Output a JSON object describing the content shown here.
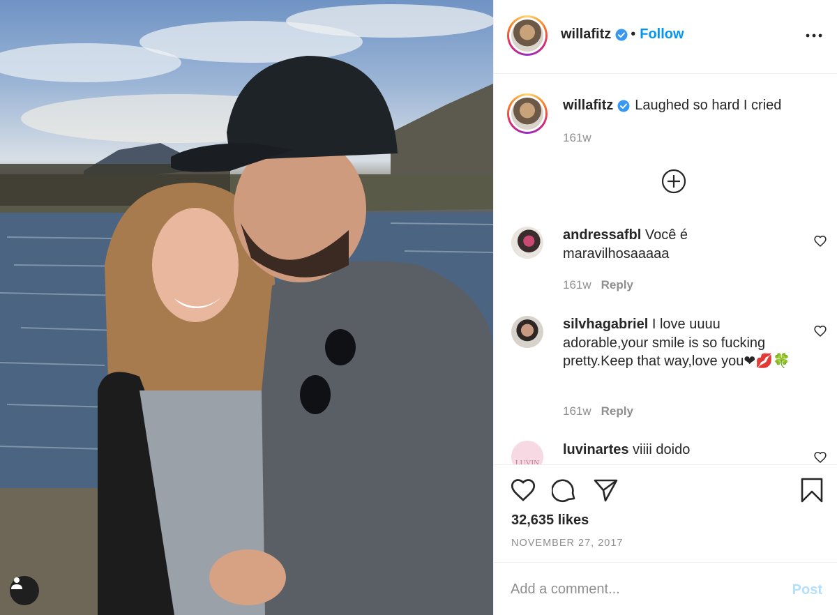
{
  "post": {
    "author": "willafitz",
    "follow_label": "Follow",
    "dot": "•",
    "verified": true,
    "caption": "Laughed so hard I cried",
    "caption_time": "161w",
    "likes": "32,635 likes",
    "date": "NOVEMBER 27, 2017"
  },
  "comments": [
    {
      "user": "andressafbl",
      "text": "Você é maravilhosaaaaa",
      "time": "161w",
      "reply": "Reply"
    },
    {
      "user": "silvhagabriel",
      "text": "I love uuuu adorable,your smile is so fucking pretty.Keep that way,love you❤💋🍀",
      "time": "161w",
      "reply": "Reply"
    },
    {
      "user": "luvinartes",
      "text": "viiii doido",
      "avatar_text": "LUVIN"
    }
  ],
  "composer": {
    "placeholder": "Add a comment...",
    "post_label": "Post"
  },
  "colors": {
    "link_blue": "#0095f6",
    "post_disabled": "#b2dffc",
    "verified_blue": "#3897f0",
    "muted": "#8e8e8e"
  },
  "icons": [
    "user-tag-icon",
    "verified-icon",
    "more-options-icon",
    "load-more-icon",
    "heart-icon",
    "comment-icon",
    "share-icon",
    "bookmark-icon"
  ]
}
